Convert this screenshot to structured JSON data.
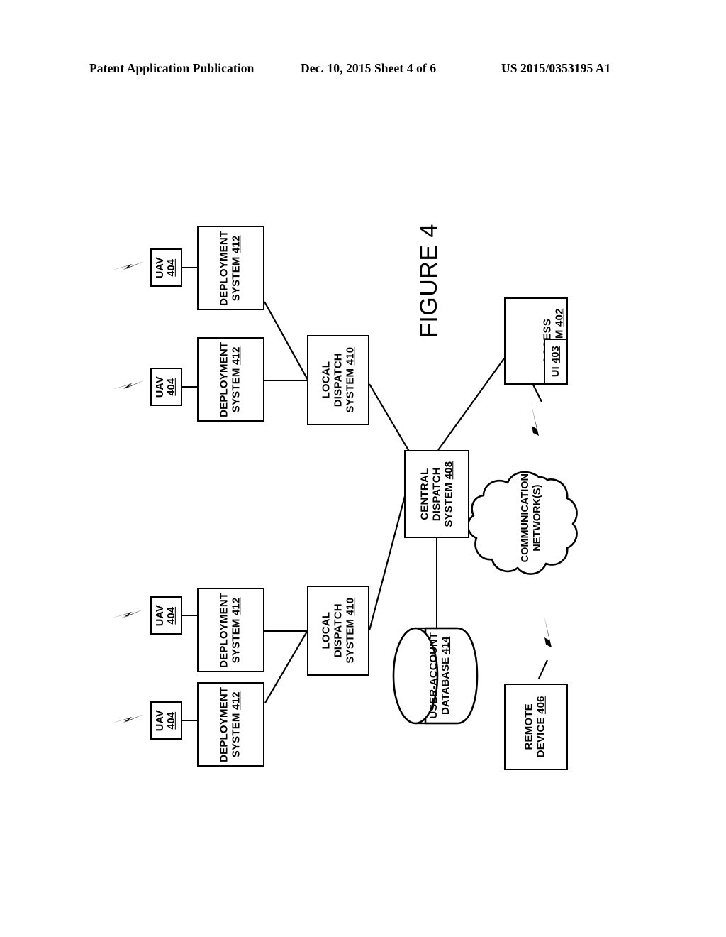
{
  "header": {
    "left": "Patent Application Publication",
    "middle": "Dec. 10, 2015  Sheet 4 of 6",
    "right": "US 2015/0353195 A1"
  },
  "figure": {
    "label": "FIGURE 4"
  },
  "nodes": {
    "uav_1": {
      "line1": "UAV",
      "line2": "404"
    },
    "uav_2": {
      "line1": "UAV",
      "line2": "404"
    },
    "uav_3": {
      "line1": "UAV",
      "line2": "404"
    },
    "uav_4": {
      "line1": "UAV",
      "line2": "404"
    },
    "deployment_1": {
      "line1": "DEPLOYMENT",
      "line2": "SYSTEM",
      "ref": "412"
    },
    "deployment_2": {
      "line1": "DEPLOYMENT",
      "line2": "SYSTEM",
      "ref": "412"
    },
    "deployment_3": {
      "line1": "DEPLOYMENT",
      "line2": "SYSTEM",
      "ref": "412"
    },
    "deployment_4": {
      "line1": "DEPLOYMENT",
      "line2": "SYSTEM",
      "ref": "412"
    },
    "local_dispatch_1": {
      "line1": "LOCAL",
      "line2": "DISPATCH",
      "line3": "SYSTEM",
      "ref": "410"
    },
    "local_dispatch_2": {
      "line1": "LOCAL",
      "line2": "DISPATCH",
      "line3": "SYSTEM",
      "ref": "410"
    },
    "central_dispatch": {
      "line1": "CENTRAL",
      "line2": "DISPATCH",
      "line3": "SYSTEM",
      "ref": "408"
    },
    "access_system": {
      "line1": "ACCESS",
      "line2": "SYSTEM",
      "ref": "402"
    },
    "user_interface": {
      "line1": "UI",
      "ref": "403"
    },
    "communication_networks": {
      "line1": "COMMUNICATION",
      "line2": "NETWORK(S)"
    },
    "user_account_database": {
      "line1": "USER-ACCOUNT",
      "line2": "DATABASE",
      "ref": "414"
    },
    "remote_device": {
      "line1": "REMOTE",
      "line2": "DEVICE",
      "ref": "406"
    }
  },
  "icons": {
    "wireless_bolt_1": "lightning-bolt-icon",
    "wireless_bolt_2": "lightning-bolt-icon",
    "wireless_bolt_3": "lightning-bolt-icon",
    "wireless_bolt_4": "lightning-bolt-icon",
    "network_bolt_upper": "lightning-bolt-icon",
    "network_bolt_lower": "lightning-bolt-icon"
  },
  "colors": {
    "ink": "#000000",
    "paper": "#ffffff"
  }
}
